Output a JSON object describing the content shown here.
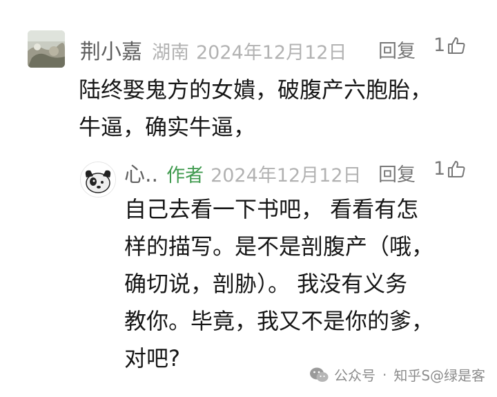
{
  "comment": {
    "author": "荆小嘉",
    "region": "湖南",
    "date": "2024年12月12日",
    "reply_label": "回复",
    "like_count": "1",
    "text_lines": [
      "陆终娶鬼方的女嬇，破腹产六胞胎，",
      "牛逼，确实牛逼，"
    ]
  },
  "reply": {
    "author": "心..",
    "author_tag": "作者",
    "date": "2024年12月12日",
    "reply_label": "回复",
    "like_count": "1",
    "text_lines": [
      "自己去看一下书吧，  看看有怎",
      "样的描写。是不是剖腹产（哦，",
      "确切说，剖胁）。  我没有义务",
      "教你。毕竟，我又不是你的爹，",
      "对吧?"
    ]
  },
  "watermark": {
    "account_label": "公众号",
    "separator": "·",
    "source": "知乎S@绿是客"
  },
  "icons": {
    "like": "thumbs-up-icon",
    "watermark": "wechat-official-account-icon"
  }
}
